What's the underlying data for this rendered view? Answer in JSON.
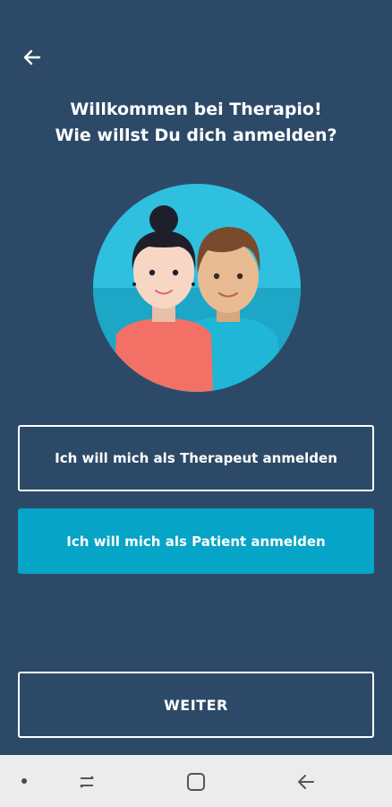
{
  "header": {
    "back_icon": "arrow-left-icon",
    "title_line1": "Willkommen bei Therapio!",
    "title_line2": "Wie willst Du dich anmelden?"
  },
  "illustration": {
    "icon": "therapist-and-patient-avatars"
  },
  "options": {
    "therapeut_label": "Ich will mich als Therapeut anmelden",
    "patient_label": "Ich will mich als Patient anmelden",
    "selected": "patient"
  },
  "footer": {
    "weiter_label": "WEITER"
  },
  "system_nav": {
    "items": [
      "dot-indicator",
      "recent-apps-icon",
      "home-icon",
      "back-icon"
    ]
  },
  "colors": {
    "background": "#2c4a67",
    "accent": "#06a4c6",
    "nav_bar": "#ececec"
  }
}
